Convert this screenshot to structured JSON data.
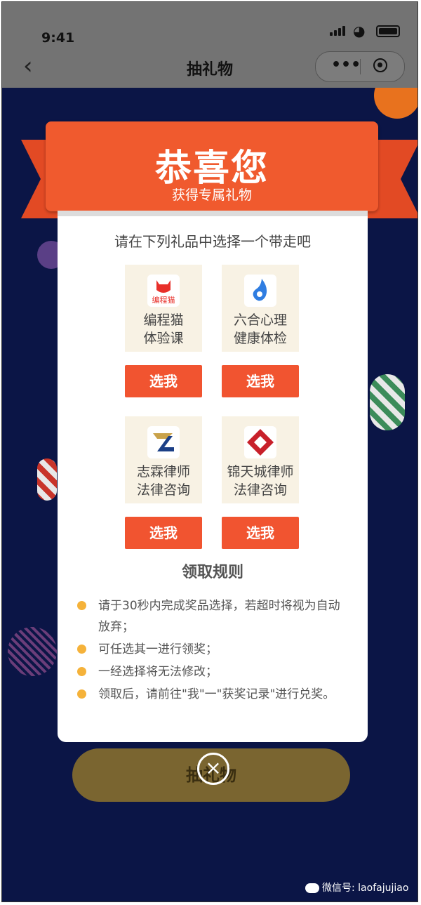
{
  "status_bar": {
    "time": "9:41"
  },
  "nav": {
    "title": "抽礼物"
  },
  "ribbon": {
    "title": "恭喜您",
    "subtitle": "获得专属礼物"
  },
  "dialog": {
    "prompt": "请在下列礼品中选择一个带走吧",
    "gifts": [
      {
        "logo_text": "编程猫",
        "name_line1": "编程猫",
        "name_line2": "体验课",
        "button": "选我",
        "logo_color": "#e8302a"
      },
      {
        "name_line1": "六合心理",
        "name_line2": "健康体检",
        "button": "选我",
        "logo_color": "#2f7de1"
      },
      {
        "name_line1": "志霖律师",
        "name_line2": "法律咨询",
        "button": "选我",
        "logo_color": "#1b3f86"
      },
      {
        "name_line1": "锦天城律师",
        "name_line2": "法律咨询",
        "button": "选我",
        "logo_color": "#c8202a"
      }
    ],
    "rules_title": "领取规则",
    "rules": [
      "请于30秒内完成奖品选择，若超时将视为自动放弃；",
      "可任选其一进行领奖；",
      "一经选择将无法修改；",
      "领取后，请前往\"我\"一\"获奖记录\"进行兑奖。"
    ]
  },
  "background_button": {
    "label": "抽礼物"
  },
  "close_icon": "close-icon",
  "watermark": {
    "text": "微信号: laofajujiao"
  },
  "colors": {
    "accent": "#f15430",
    "rule_dot": "#f5b23a",
    "gift_bg": "#f8f2e4"
  }
}
